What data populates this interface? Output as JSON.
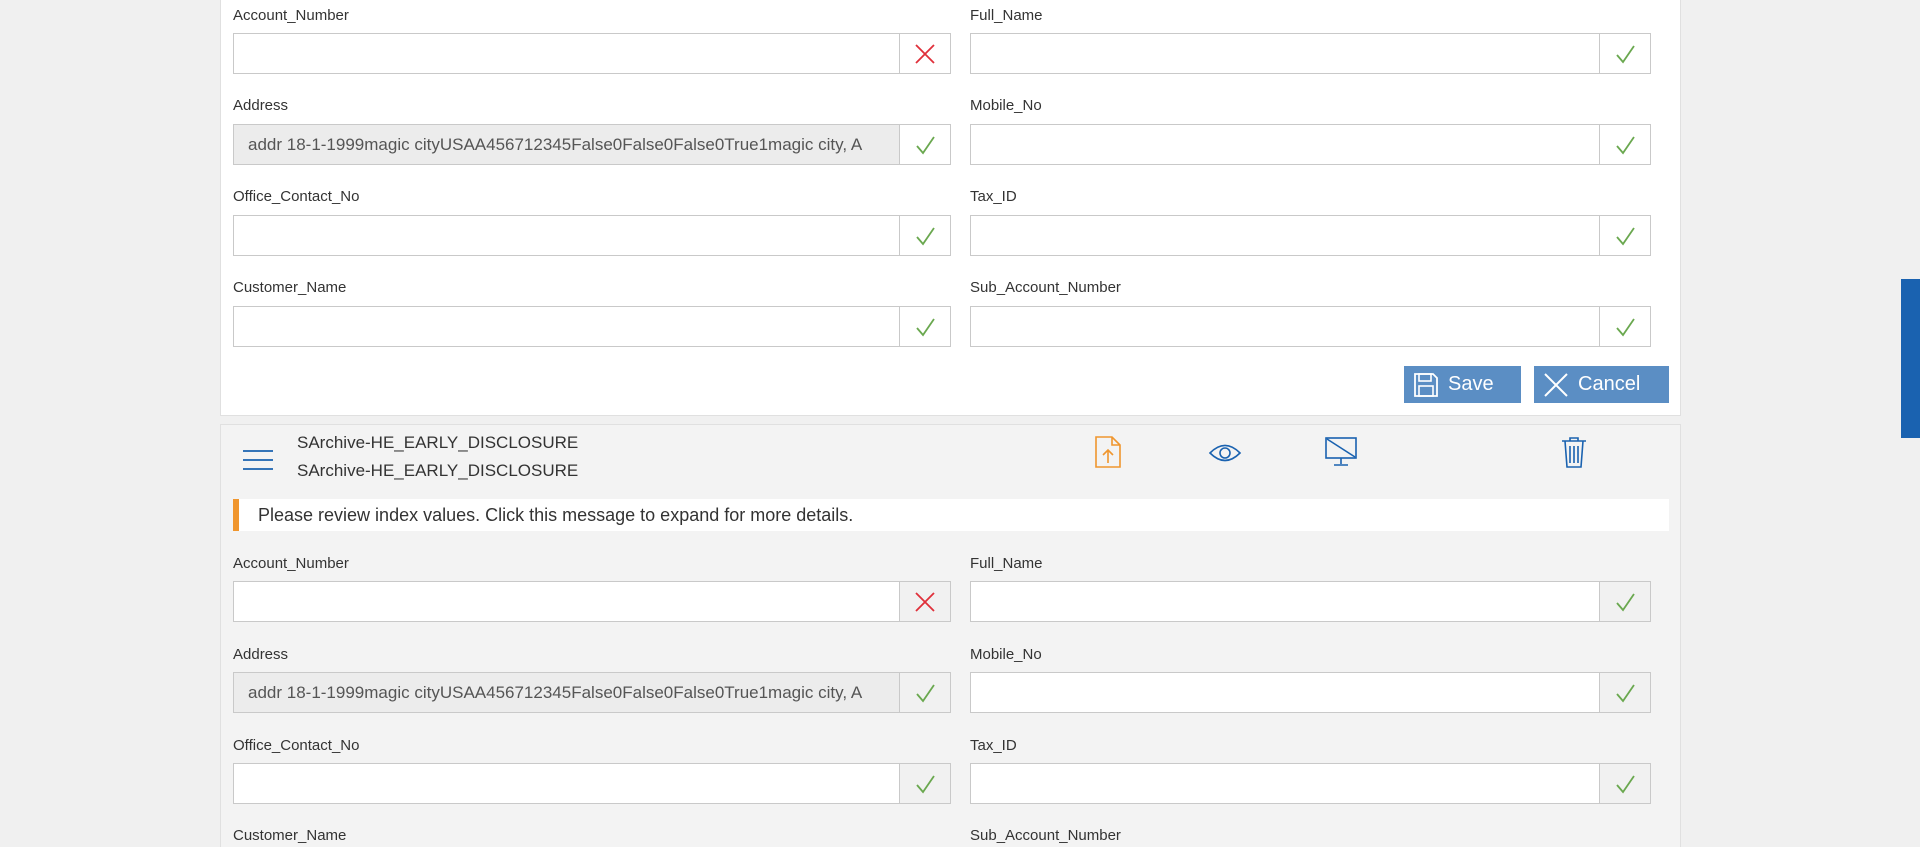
{
  "top_form": {
    "account_number": {
      "label": "Account_Number",
      "value": "",
      "status": "invalid"
    },
    "full_name": {
      "label": "Full_Name",
      "value": "",
      "status": "valid"
    },
    "address": {
      "label": "Address",
      "value": "addr 18-1-1999magic cityUSAA456712345False0False0False0True1magic city, A",
      "status": "valid"
    },
    "mobile_no": {
      "label": "Mobile_No",
      "value": "",
      "status": "valid"
    },
    "office_contact_no": {
      "label": "Office_Contact_No",
      "value": "",
      "status": "valid"
    },
    "tax_id": {
      "label": "Tax_ID",
      "value": "",
      "status": "valid"
    },
    "customer_name": {
      "label": "Customer_Name",
      "value": "",
      "status": "valid"
    },
    "sub_account_number": {
      "label": "Sub_Account_Number",
      "value": "",
      "status": "valid"
    }
  },
  "actions": {
    "save_label": "Save",
    "cancel_label": "Cancel"
  },
  "document": {
    "title_line1": "SArchive-HE_EARLY_DISCLOSURE",
    "title_line2": "SArchive-HE_EARLY_DISCLOSURE",
    "icons": [
      "menu-icon",
      "upload-icon",
      "view-icon",
      "display-off-icon",
      "trash-icon"
    ]
  },
  "notice": {
    "text": "Please review index values. Click this message to expand for more details."
  },
  "bottom_form": {
    "account_number": {
      "label": "Account_Number",
      "value": "",
      "status": "invalid"
    },
    "full_name": {
      "label": "Full_Name",
      "value": "",
      "status": "valid"
    },
    "address": {
      "label": "Address",
      "value": "addr 18-1-1999magic cityUSAA456712345False0False0False0True1magic city, A",
      "status": "valid"
    },
    "mobile_no": {
      "label": "Mobile_No",
      "value": "",
      "status": "valid"
    },
    "office_contact_no": {
      "label": "Office_Contact_No",
      "value": "",
      "status": "valid"
    },
    "tax_id": {
      "label": "Tax_ID",
      "value": "",
      "status": "valid"
    },
    "customer_name": {
      "label": "Customer_Name"
    },
    "sub_account_number": {
      "label": "Sub_Account_Number"
    }
  },
  "colors": {
    "accent": "#5b8ec4",
    "valid": "#6aa84f",
    "invalid": "#e0303a",
    "notice": "#f0962e",
    "scrollbar": "#1a62b0"
  }
}
